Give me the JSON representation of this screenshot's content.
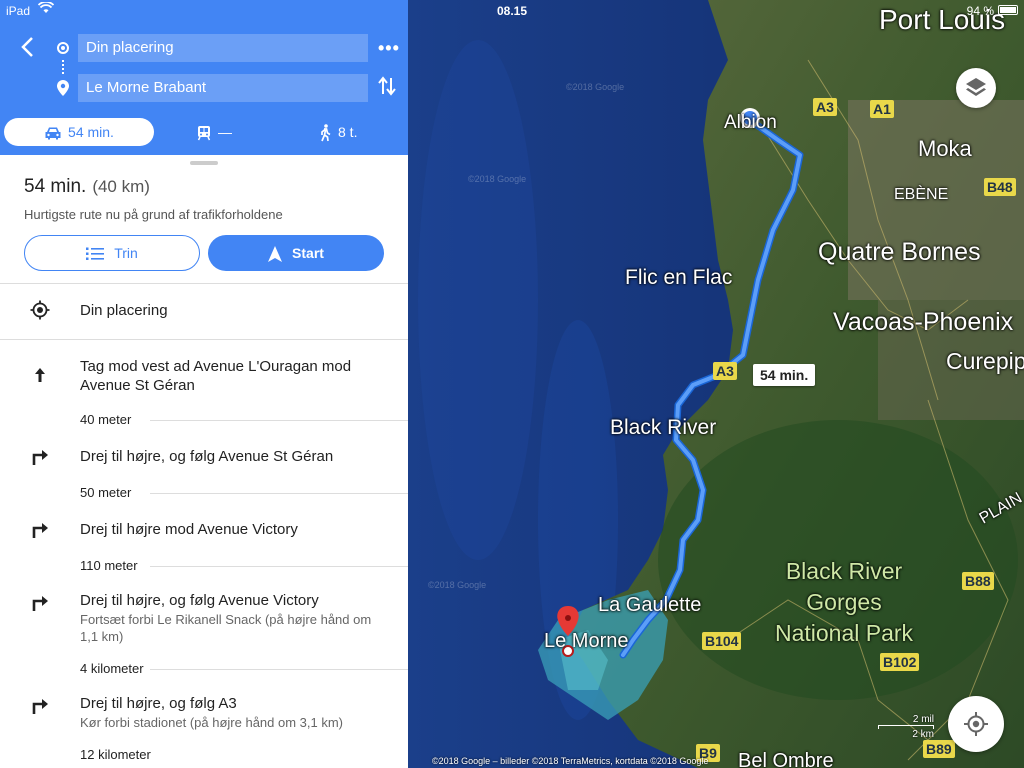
{
  "status": {
    "device": "iPad",
    "time": "08.15",
    "battery": "94 %"
  },
  "header": {
    "origin": "Din placering",
    "destination": "Le Morne Brabant",
    "more_icon": "more-icon",
    "swap_icon": "swap-icon"
  },
  "modes": {
    "car": "54 min.",
    "transit": "—",
    "walk": "8 t."
  },
  "summary": {
    "time": "54 min.",
    "distance": "(40 km)",
    "note": "Hurtigste rute nu på grund af trafikforholdene",
    "steps_button": "Trin",
    "start_button": "Start"
  },
  "steps": [
    {
      "text": "Din placering"
    },
    {
      "text": "Tag mod vest ad Avenue L'Ouragan mod Avenue St Géran",
      "distance": "40 meter"
    },
    {
      "text": "Drej til højre, og følg Avenue St Géran",
      "distance": "50 meter"
    },
    {
      "text": "Drej til højre mod Avenue Victory",
      "distance": "110 meter"
    },
    {
      "text": "Drej til højre, og følg Avenue Victory",
      "sub": "Fortsæt forbi Le Rikanell Snack (på højre hånd om 1,1 km)",
      "distance": "4 kilometer"
    },
    {
      "text": "Drej til højre, og følg A3",
      "sub": "Kør forbi stadionet (på højre hånd om 3,1 km)",
      "distance": "12 kilometer"
    }
  ],
  "map": {
    "places": {
      "port_louis": "Port Louis",
      "albion": "Albion",
      "moka": "Moka",
      "ebene": "EBÈNE",
      "quatre_bornes": "Quatre Bornes",
      "flic_en_flac": "Flic en Flac",
      "vacoas": "Vacoas-Phoenix",
      "curepipe": "Curepip",
      "black_river": "Black River",
      "plain": "PLAIN",
      "black_river_gorges": "Black River Gorges National Park",
      "la_gaulette": "La Gaulette",
      "le_morne": "Le Morne",
      "bel_ombre": "Bel Ombre"
    },
    "roads": {
      "a3a": "A3",
      "a1": "A1",
      "b48": "B48",
      "a3b": "A3",
      "b88": "B88",
      "b104": "B104",
      "b102": "B102",
      "b9": "B9",
      "b89": "B89"
    },
    "route_time": "54 min.",
    "scale_mi": "2 mil",
    "scale_km": "2 km",
    "copyright": "©2018 Google – billeder ©2018 TerraMetrics, kortdata ©2018 Google",
    "watermark": "©2018 Google"
  }
}
